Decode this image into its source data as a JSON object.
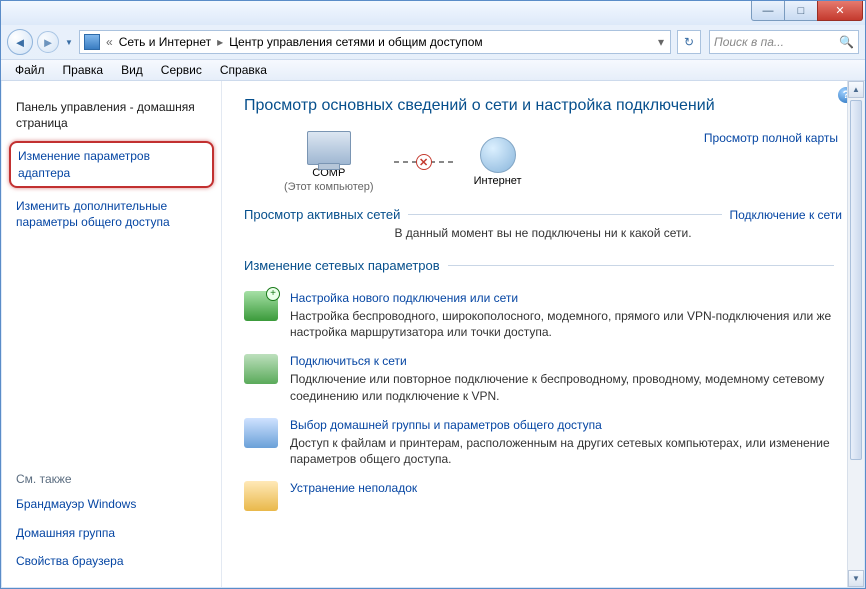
{
  "breadcrumb": {
    "seg1": "Сеть и Интернет",
    "seg2": "Центр управления сетями и общим доступом"
  },
  "search": {
    "placeholder": "Поиск в па..."
  },
  "menu": {
    "file": "Файл",
    "edit": "Правка",
    "view": "Вид",
    "service": "Сервис",
    "help": "Справка"
  },
  "sidebar": {
    "home": "Панель управления - домашняя страница",
    "adapter": "Изменение параметров адаптера",
    "sharing": "Изменить дополнительные параметры общего доступа",
    "seealso": "См. также",
    "firewall": "Брандмауэр Windows",
    "homegroup": "Домашняя группа",
    "browser": "Свойства браузера"
  },
  "main": {
    "title": "Просмотр основных сведений о сети и настройка подключений",
    "fullmap": "Просмотр полной карты",
    "node1": "COMP",
    "node1_sub": "(Этот компьютер)",
    "node2": "Интернет",
    "active_label": "Просмотр активных сетей",
    "connect_link": "Подключение к сети",
    "active_sub": "В данный момент вы не подключены ни к какой сети.",
    "change_label": "Изменение сетевых параметров",
    "opts": [
      {
        "title": "Настройка нового подключения или сети",
        "desc": "Настройка беспроводного, широкополосного, модемного, прямого или VPN-подключения или же настройка маршрутизатора или точки доступа."
      },
      {
        "title": "Подключиться к сети",
        "desc": "Подключение или повторное подключение к беспроводному, проводному, модемному сетевому соединению или подключение к VPN."
      },
      {
        "title": "Выбор домашней группы и параметров общего доступа",
        "desc": "Доступ к файлам и принтерам, расположенным на других сетевых компьютерах, или изменение параметров общего доступа."
      },
      {
        "title": "Устранение неполадок",
        "desc": ""
      }
    ]
  }
}
